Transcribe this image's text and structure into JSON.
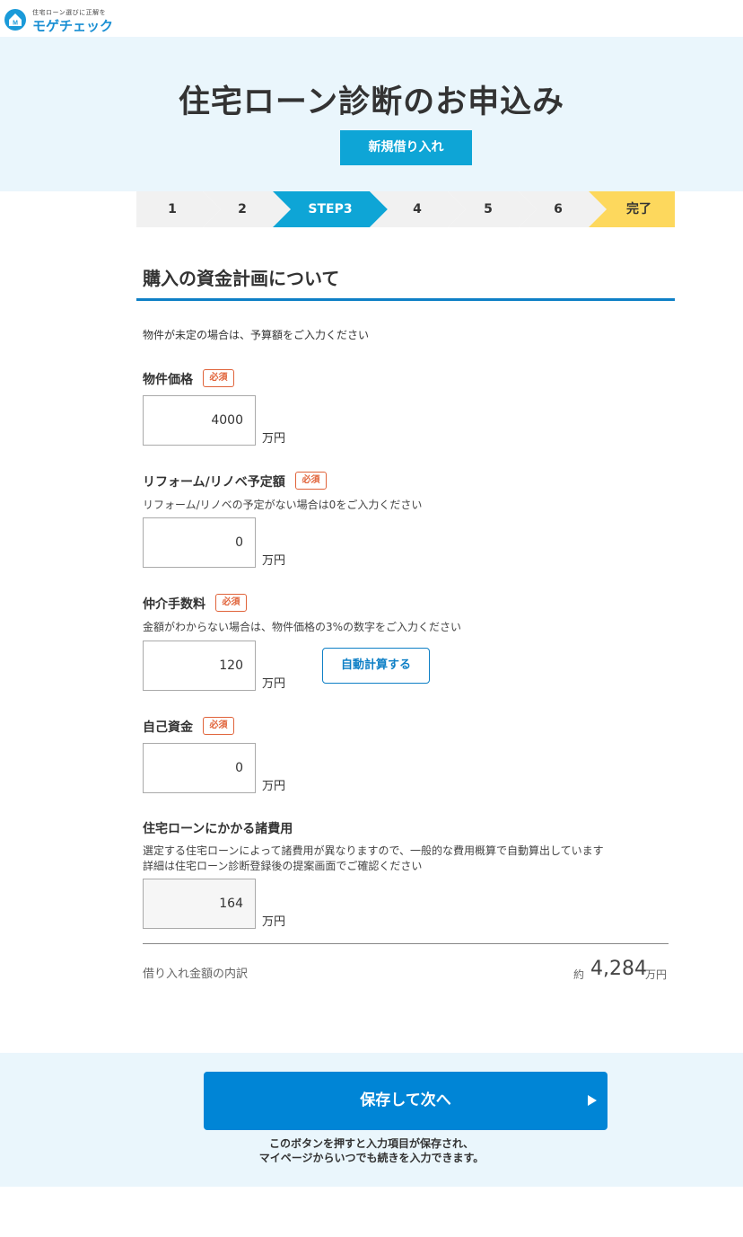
{
  "logo": {
    "tagline": "住宅ローン選びに正解を",
    "name": "モゲチェック",
    "mark_letter": "M"
  },
  "hero": {
    "title": "住宅ローン診断のお申込み",
    "badge": "新規借り入れ"
  },
  "steps": [
    {
      "label": "1",
      "state": "done"
    },
    {
      "label": "2",
      "state": "done"
    },
    {
      "label": "STEP3",
      "state": "active"
    },
    {
      "label": "4",
      "state": "todo"
    },
    {
      "label": "5",
      "state": "todo"
    },
    {
      "label": "6",
      "state": "todo"
    },
    {
      "label": "完了",
      "state": "final"
    }
  ],
  "colors": {
    "accent": "#0ea5d6",
    "step_inactive": "#f1f1f1",
    "step_final": "#fdd85d",
    "required": "#e0633a",
    "primary": "#0085d6"
  },
  "section": {
    "title": "購入の資金計画について",
    "intro": "物件が未定の場合は、予算額をご入力ください"
  },
  "required_label": "必須",
  "fields": {
    "price": {
      "label": "物件価格",
      "value": "4000",
      "unit": "万円"
    },
    "reform": {
      "label": "リフォーム/リノベ予定額",
      "hint": "リフォーム/リノベの予定がない場合は0をご入力ください",
      "value": "0",
      "unit": "万円"
    },
    "commission": {
      "label": "仲介手数料",
      "hint": "金額がわからない場合は、物件価格の3%の数字をご入力ください",
      "value": "120",
      "unit": "万円",
      "button": "自動計算する"
    },
    "own_funds": {
      "label": "自己資金",
      "value": "0",
      "unit": "万円"
    },
    "loan_costs": {
      "label": "住宅ローンにかかる諸費用",
      "hint_1": "選定する住宅ローンによって諸費用が異なりますので、一般的な費用概算で自動算出しています",
      "hint_2": "詳細は住宅ローン診断登録後の提案画面でご確認ください",
      "value": "164",
      "unit": "万円"
    }
  },
  "summary": {
    "label": "借り入れ金額の内訳",
    "prefix": "約",
    "value": "4,284",
    "unit": "万円"
  },
  "footer": {
    "button": "保存して次へ",
    "note_1": "このボタンを押すと入力項目が保存され、",
    "note_2": "マイページからいつでも続きを入力できます。"
  }
}
